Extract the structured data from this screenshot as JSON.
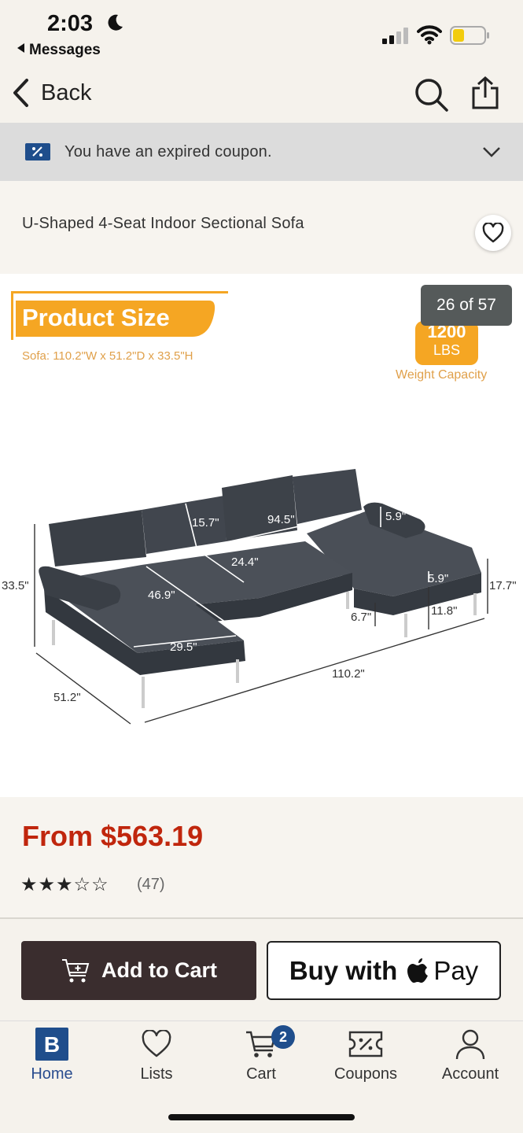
{
  "status_bar": {
    "time": "2:03",
    "back_app": "Messages"
  },
  "nav": {
    "back_label": "Back"
  },
  "coupon_banner": {
    "text": "You have an expired coupon."
  },
  "product": {
    "title": "U-Shaped 4-Seat Indoor Sectional Sofa",
    "image_counter": "26 of 57",
    "price": "From $563.19",
    "rating_stars": 3,
    "rating_max": 5,
    "stars_text": "★★★☆☆",
    "review_count": "(47)"
  },
  "image_text": {
    "heading": "Product Size",
    "subheading": "Sofa: 110.2\"W x 51.2\"D x 33.5\"H",
    "weight_value": "1200",
    "weight_unit": "LBS",
    "weight_label": "Weight Capacity",
    "dims": {
      "d1": "15.7\"",
      "d2": "94.5\"",
      "d3": "5.9\"",
      "d4": "24.4\"",
      "d5": "33.5\"",
      "d6": "46.9\"",
      "d7": "5.9\"",
      "d8": "17.7\"",
      "d9": "6.7\"",
      "d10": "11.8\"",
      "d11": "29.5\"",
      "d12": "110.2\"",
      "d13": "51.2\""
    }
  },
  "actions": {
    "add_to_cart": "Add to Cart",
    "buy_with": "Buy with",
    "pay": "Pay"
  },
  "tabbar": {
    "home": "Home",
    "lists": "Lists",
    "cart": "Cart",
    "cart_badge": "2",
    "coupons": "Coupons",
    "account": "Account"
  },
  "colors": {
    "price": "#c0260d",
    "cart_button": "#3a2d2e",
    "accent_blue": "#1f4e8c",
    "orange": "#f5a623"
  }
}
